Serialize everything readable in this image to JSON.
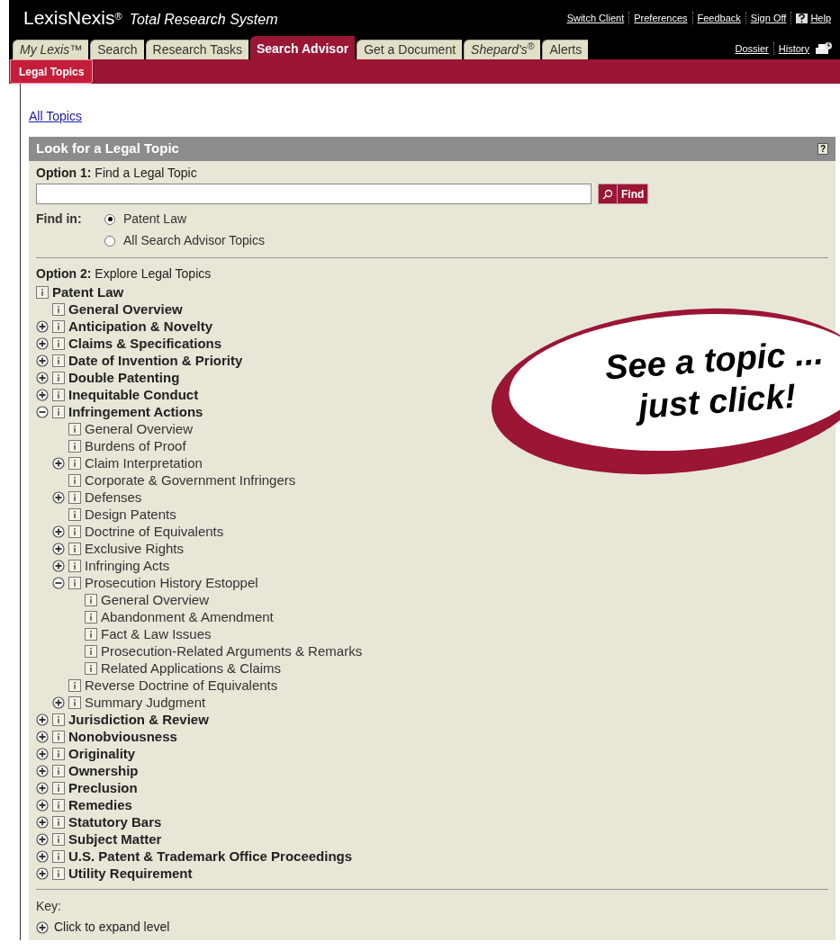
{
  "brand": {
    "name": "LexisNexis",
    "reg": "®",
    "product": "Total Research System"
  },
  "top_links": [
    "Switch Client",
    "Preferences",
    "Feedback",
    "Sign Off",
    "Help"
  ],
  "tabs": [
    {
      "label": "My Lexis™",
      "italic": true,
      "selected": false
    },
    {
      "label": "Search",
      "italic": false,
      "selected": false
    },
    {
      "label": "Research Tasks",
      "italic": false,
      "selected": false
    },
    {
      "label": "Search Advisor",
      "italic": false,
      "selected": true
    },
    {
      "label": "Get a Document",
      "italic": false,
      "selected": false
    },
    {
      "label": "Shepard's$^{®}$",
      "italic": true,
      "selected": false
    },
    {
      "label": "Alerts",
      "italic": false,
      "selected": false
    }
  ],
  "side_links": [
    "Dossier",
    "History"
  ],
  "subtabs": [
    {
      "label": "Legal Topics",
      "selected": true
    }
  ],
  "breadcrumb": "All Topics",
  "panel": {
    "title": "Look for a Legal Topic",
    "help": "?",
    "option1": "**Option 1:** Find a Legal Topic",
    "find_button": "Find",
    "find_in_label": "Find in:",
    "scopes": [
      {
        "label": "Patent Law",
        "selected": true
      },
      {
        "label": "All Search Advisor Topics",
        "selected": false
      }
    ],
    "option2": "**Option 2:** Explore Legal Topics"
  },
  "tree": [
    {
      "label": "Patent Law",
      "children": [
        {
          "label": "General Overview"
        },
        {
          "label": "Anticipation & Novelty",
          "expanded": false
        },
        {
          "label": "Claims & Specifications",
          "expanded": false
        },
        {
          "label": "Date of Invention & Priority",
          "expanded": false
        },
        {
          "label": "Double Patenting",
          "expanded": false
        },
        {
          "label": "Inequitable Conduct",
          "expanded": false
        },
        {
          "label": "Infringement Actions",
          "expanded": true,
          "children": [
            {
              "label": "General Overview"
            },
            {
              "label": "Burdens of Proof"
            },
            {
              "label": "Claim Interpretation",
              "expanded": false
            },
            {
              "label": "Corporate & Government Infringers"
            },
            {
              "label": "Defenses",
              "expanded": false
            },
            {
              "label": "Design Patents"
            },
            {
              "label": "Doctrine of Equivalents",
              "expanded": false
            },
            {
              "label": "Exclusive Rights",
              "expanded": false
            },
            {
              "label": "Infringing Acts",
              "expanded": false
            },
            {
              "label": "Prosecution History Estoppel",
              "expanded": true,
              "children": [
                {
                  "label": "General Overview"
                },
                {
                  "label": "Abandonment & Amendment"
                },
                {
                  "label": "Fact & Law Issues"
                },
                {
                  "label": "Prosecution-Related Arguments & Remarks"
                },
                {
                  "label": "Related Applications & Claims"
                }
              ]
            },
            {
              "label": "Reverse Doctrine of Equivalents"
            },
            {
              "label": "Summary Judgment",
              "expanded": false
            }
          ]
        },
        {
          "label": "Jurisdiction & Review",
          "expanded": false
        },
        {
          "label": "Nonobviousness",
          "expanded": false
        },
        {
          "label": "Originality",
          "expanded": false
        },
        {
          "label": "Ownership",
          "expanded": false
        },
        {
          "label": "Preclusion",
          "expanded": false
        },
        {
          "label": "Remedies",
          "expanded": false
        },
        {
          "label": "Statutory Bars",
          "expanded": false
        },
        {
          "label": "Subject Matter",
          "expanded": false
        },
        {
          "label": "U.S. Patent & Trademark Office Proceedings",
          "expanded": false
        },
        {
          "label": "Utility Requirement",
          "expanded": false
        }
      ]
    }
  ],
  "key": {
    "title": "Key:",
    "items": [
      {
        "kind": "expand",
        "label": "Click to expand level"
      }
    ]
  },
  "callout": {
    "lines": [
      "See a topic ...",
      "just click!"
    ]
  }
}
